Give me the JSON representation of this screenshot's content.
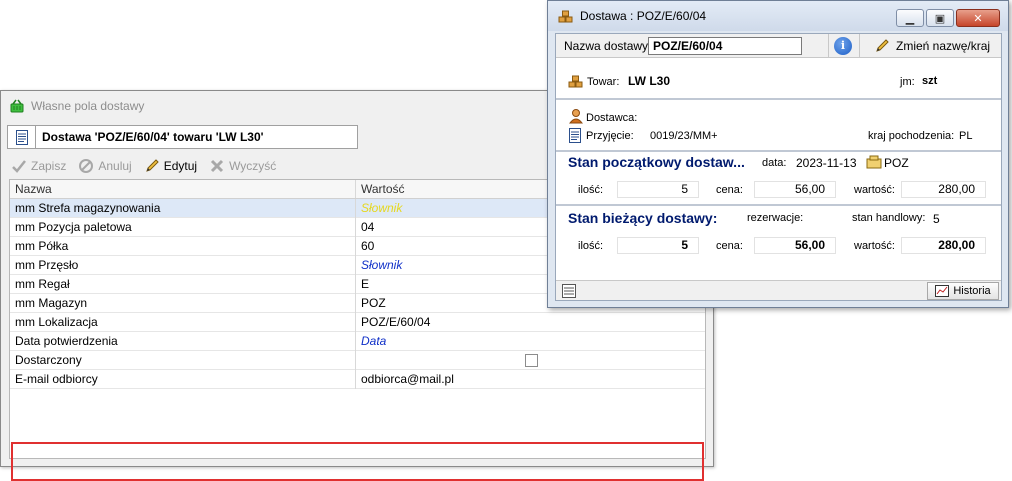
{
  "win1": {
    "title": "Własne pola dostawy",
    "header": "Dostawa 'POZ/E/60/04' towaru 'LW L30'",
    "toolbar": {
      "save": "Zapisz",
      "cancel": "Anuluj",
      "edit": "Edytuj",
      "clear": "Wyczyść"
    },
    "columns": {
      "name": "Nazwa",
      "value": "Wartość"
    },
    "rows": [
      {
        "name": "mm Strefa magazynowania",
        "value": "Słownik"
      },
      {
        "name": "mm Pozycja paletowa",
        "value": "04"
      },
      {
        "name": "mm Półka",
        "value": "60"
      },
      {
        "name": "mm Przęsło",
        "value": "Słownik"
      },
      {
        "name": "mm Regał",
        "value": "E"
      },
      {
        "name": "mm Magazyn",
        "value": "POZ"
      },
      {
        "name": "mm Lokalizacja",
        "value": "POZ/E/60/04"
      },
      {
        "name": "Data potwierdzenia",
        "value": "Data"
      },
      {
        "name": "Dostarczony",
        "value": ""
      },
      {
        "name": "E-mail odbiorcy",
        "value": "odbiorca@mail.pl"
      }
    ],
    "highlight_color": "#e03030"
  },
  "win2": {
    "title": "Dostawa : POZ/E/60/04",
    "nazwa_label": "Nazwa dostawy:",
    "nazwa_value": "POZ/E/60/04",
    "rename": "Zmień nazwę/kraj",
    "towar_label": "Towar:",
    "towar_value": "LW L30",
    "jm_label": "jm:",
    "jm_value": "szt",
    "dostawca_label": "Dostawca:",
    "przyjecie_label": "Przyjęcie:",
    "przyjecie_value": "0019/23/MM+",
    "kraj_label": "kraj pochodzenia:",
    "kraj_value": "PL",
    "stan_pocz_title": "Stan początkowy dostaw...",
    "data_label": "data:",
    "data_value": "2023-11-13",
    "mag_value": "POZ",
    "ilosc_label": "ilość:",
    "cena_label": "cena:",
    "wartosc_label": "wartość:",
    "pocz_ilosc": "5",
    "pocz_cena": "56,00",
    "pocz_wartosc": "280,00",
    "stan_biez_title": "Stan bieżący dostawy:",
    "rezerwacje_label": "rezerwacje:",
    "stan_handlowy_label": "stan handlowy:",
    "stan_handlowy_value": "5",
    "biez_ilosc": "5",
    "biez_cena": "56,00",
    "biez_wartosc": "280,00",
    "historia": "Historia",
    "title_color": "#001a6e"
  }
}
